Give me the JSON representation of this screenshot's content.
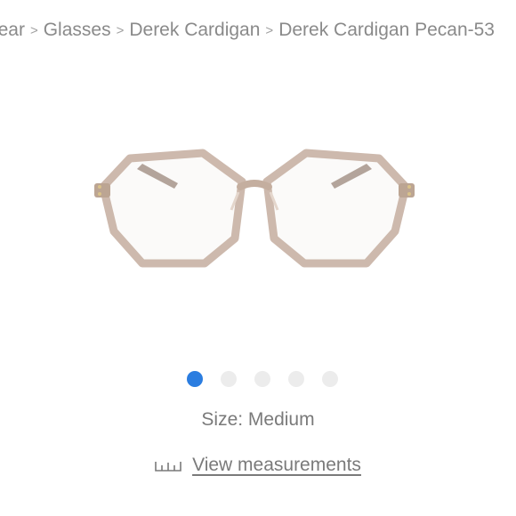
{
  "breadcrumb": {
    "items": [
      "wear",
      "Glasses",
      "Derek Cardigan",
      "Derek Cardigan Pecan-53"
    ],
    "separator": ">"
  },
  "gallery": {
    "dot_count": 5,
    "active_index": 0,
    "active_color": "#2b7de0",
    "inactive_color": "#ececec"
  },
  "product": {
    "size_text": "Size: Medium",
    "measurements_link": "View measurements",
    "frame_color": "#cdb9ad"
  },
  "icons": {
    "measurements": "ruler-icon"
  }
}
